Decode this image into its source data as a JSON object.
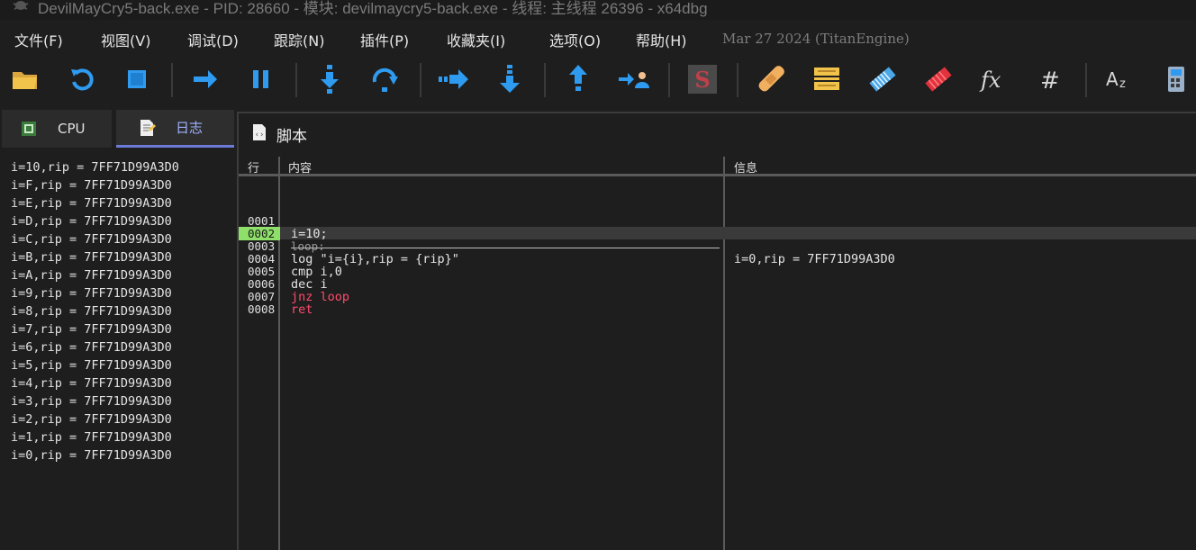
{
  "window": {
    "title": "DevilMayCry5-back.exe - PID: 28660 - 模块: devilmaycry5-back.exe - 线程: 主线程 26396 - x64dbg"
  },
  "menu": {
    "items": [
      "文件(F)",
      "视图(V)",
      "调试(D)",
      "跟踪(N)",
      "插件(P)",
      "收藏夹(I)",
      "选项(O)",
      "帮助(H)"
    ],
    "build_date": "Mar 27 2024 (TitanEngine)"
  },
  "toolbar": {
    "buttons": [
      "open-icon",
      "restart-icon",
      "stop-icon",
      "run-icon",
      "pause-icon",
      "step-into-icon",
      "step-over-icon",
      "trace-into-icon",
      "trace-over-icon",
      "execute-till-return-icon",
      "run-to-user-code-icon",
      "scylla-icon",
      "patch-icon",
      "comments-icon",
      "labels-icon",
      "bookmarks-icon",
      "functions-icon",
      "variables-icon",
      "strings-icon",
      "calculator-icon"
    ],
    "colors": {
      "blue": "#2f9bf0",
      "red": "#e2323e",
      "yellow": "#f2c34a"
    }
  },
  "tabs": [
    {
      "label": "CPU",
      "active": false
    },
    {
      "label": "日志",
      "active": true
    }
  ],
  "log": {
    "lines": [
      "i=10,rip = 7FF71D99A3D0",
      "i=F,rip = 7FF71D99A3D0",
      "i=E,rip = 7FF71D99A3D0",
      "i=D,rip = 7FF71D99A3D0",
      "i=C,rip = 7FF71D99A3D0",
      "i=B,rip = 7FF71D99A3D0",
      "i=A,rip = 7FF71D99A3D0",
      "i=9,rip = 7FF71D99A3D0",
      "i=8,rip = 7FF71D99A3D0",
      "i=7,rip = 7FF71D99A3D0",
      "i=6,rip = 7FF71D99A3D0",
      "i=5,rip = 7FF71D99A3D0",
      "i=4,rip = 7FF71D99A3D0",
      "i=3,rip = 7FF71D99A3D0",
      "i=2,rip = 7FF71D99A3D0",
      "i=1,rip = 7FF71D99A3D0",
      "i=0,rip = 7FF71D99A3D0"
    ]
  },
  "script": {
    "title": "脚本",
    "columns": {
      "line": "行",
      "content": "内容",
      "info": "信息"
    },
    "rows": [
      {
        "num": "0001",
        "code": ""
      },
      {
        "num": "0002",
        "code": "i=10;"
      },
      {
        "num": "0003",
        "code": "loop:"
      },
      {
        "num": "0004",
        "code": "log \"i={i},rip = {rip}\""
      },
      {
        "num": "0005",
        "code": "cmp i,0"
      },
      {
        "num": "0006",
        "code": "dec i"
      },
      {
        "num": "0007",
        "code": "jnz loop"
      },
      {
        "num": "0008",
        "code": "ret"
      }
    ],
    "info": "i=0,rip = 7FF71D99A3D0",
    "current_line": "0002"
  }
}
